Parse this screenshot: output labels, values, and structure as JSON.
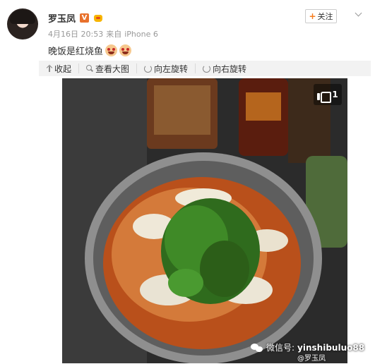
{
  "user": {
    "name": "罗玉凤",
    "verified_badge": "V",
    "crown_icon": "crown-icon"
  },
  "follow_button": {
    "label": "关注"
  },
  "meta": {
    "date": "4月16日 20:53",
    "source_prefix": "来自",
    "source": "iPhone 6"
  },
  "post": {
    "text": "晚饭是红烧鱼",
    "emoji_count": 2,
    "emoji_icon": "drooling-face-icon"
  },
  "toolbar": {
    "items": [
      {
        "label": "收起",
        "icon": "collapse-icon"
      },
      {
        "label": "查看大图",
        "icon": "search-icon"
      },
      {
        "label": "向左旋转",
        "icon": "rotate-left-icon"
      },
      {
        "label": "向右旋转",
        "icon": "rotate-right-icon"
      }
    ]
  },
  "photo": {
    "like_count": "1",
    "watermark_label": "微信号:",
    "watermark_handle": "yinshibuluo88",
    "weibo_mark": "@罗玉凤"
  },
  "colors": {
    "follow_plus": "#f77c1d",
    "verified": "#e8712c",
    "meta_text": "#999999",
    "toolbar_bg": "#f2f2f2"
  }
}
